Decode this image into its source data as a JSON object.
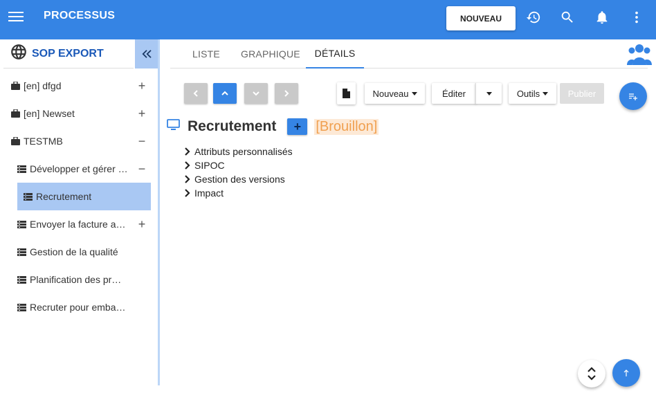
{
  "topbar": {
    "title": "PROCESSUS",
    "new_label": "NOUVEAU",
    "icons": [
      "menu-icon",
      "history-icon",
      "search-icon",
      "bell-icon",
      "more-vert-icon"
    ]
  },
  "sidebar": {
    "header": "SOP EXPORT",
    "items": [
      {
        "label": "[en] dfgd",
        "toggle": "+"
      },
      {
        "label": "[en] Newset",
        "toggle": "+"
      },
      {
        "label": "TESTMB",
        "toggle": "−"
      },
      {
        "label": "Développer et gérer les produits",
        "toggle": "−"
      },
      {
        "label": "Recrutement",
        "toggle": ""
      },
      {
        "label": "Envoyer la facture au client",
        "toggle": "+"
      },
      {
        "label": "Gestion de la qualité",
        "toggle": ""
      },
      {
        "label": "Planification des production",
        "toggle": ""
      },
      {
        "label": "Recruter pour embaucher",
        "toggle": ""
      }
    ]
  },
  "tabs": [
    {
      "label": "LISTE"
    },
    {
      "label": "GRAPHIQUE"
    },
    {
      "label": "DÉTAILS"
    }
  ],
  "toolbar": {
    "nouveau": "Nouveau",
    "editer": "Éditer",
    "outils": "Outils",
    "publier": "Publier"
  },
  "process": {
    "title": "Recrutement",
    "add_symbol": "+",
    "status": "[Brouillon]"
  },
  "sections": [
    {
      "label": "Attributs personnalisés"
    },
    {
      "label": "SIPOC"
    },
    {
      "label": "Gestion des versions"
    },
    {
      "label": "Impact"
    }
  ],
  "colors": {
    "primary": "#3584e4",
    "sidebar_active": "#a9c8f3",
    "status_text": "#f0a050",
    "brand_title": "#1b59b8"
  }
}
